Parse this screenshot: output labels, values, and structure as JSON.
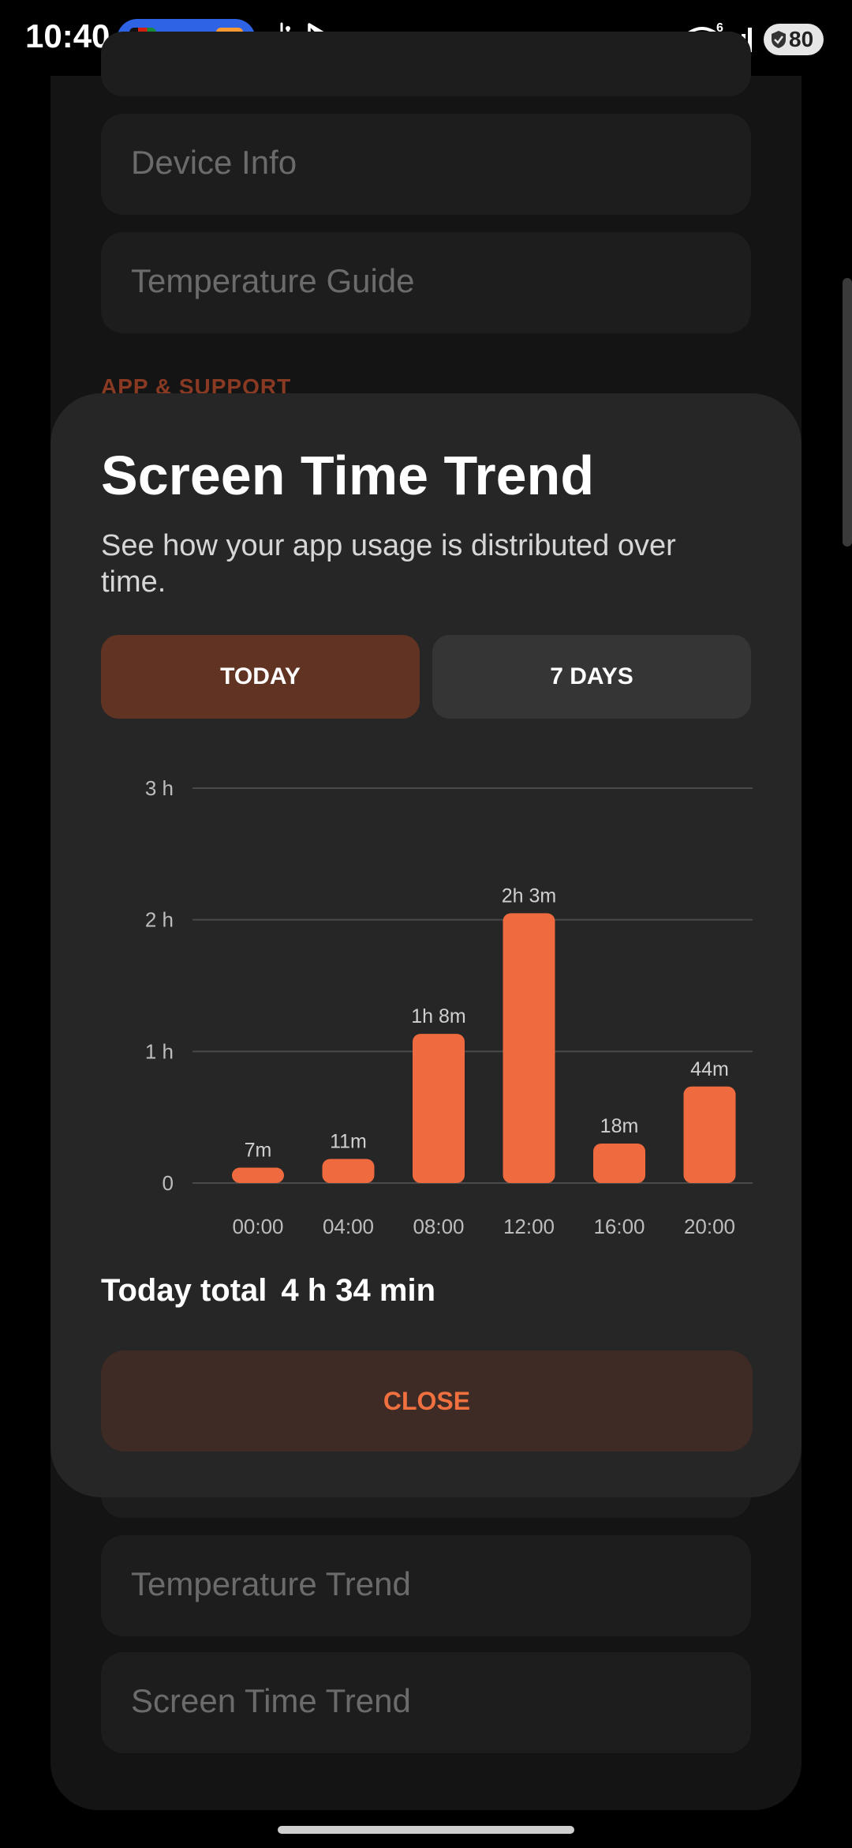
{
  "status_bar": {
    "time": "10:40",
    "battery": "80",
    "wifi_badge": "6"
  },
  "background": {
    "items_top": [
      "Device Info",
      "Temperature Guide"
    ],
    "section_label": "APP & SUPPORT",
    "items_bottom": [
      "Temperature Trend",
      "Screen Time Trend"
    ]
  },
  "dialog": {
    "title": "Screen Time Trend",
    "subtitle": "See how your app usage is distributed over time.",
    "tabs": [
      {
        "label": "TODAY",
        "selected": true
      },
      {
        "label": "7 DAYS",
        "selected": false
      }
    ],
    "total_label": "Today total",
    "total_value": "4 h 34 min",
    "close_label": "CLOSE"
  },
  "colors": {
    "accent": "#EF6B3F",
    "tab_selected": "#613322",
    "tab_unselected": "#353535",
    "close_bg": "#3E2B25",
    "dialog_bg": "#262626"
  },
  "chart_data": {
    "type": "bar",
    "categories": [
      "00:00",
      "04:00",
      "08:00",
      "12:00",
      "16:00",
      "20:00"
    ],
    "values_minutes": [
      7,
      11,
      68,
      123,
      18,
      44
    ],
    "data_labels": [
      "7m",
      "11m",
      "1h 8m",
      "2h 3m",
      "18m",
      "44m"
    ],
    "y_ticks": [
      "0",
      "1 h",
      "2 h",
      "3 h"
    ],
    "ylim_minutes": [
      0,
      180
    ],
    "grid": true
  }
}
